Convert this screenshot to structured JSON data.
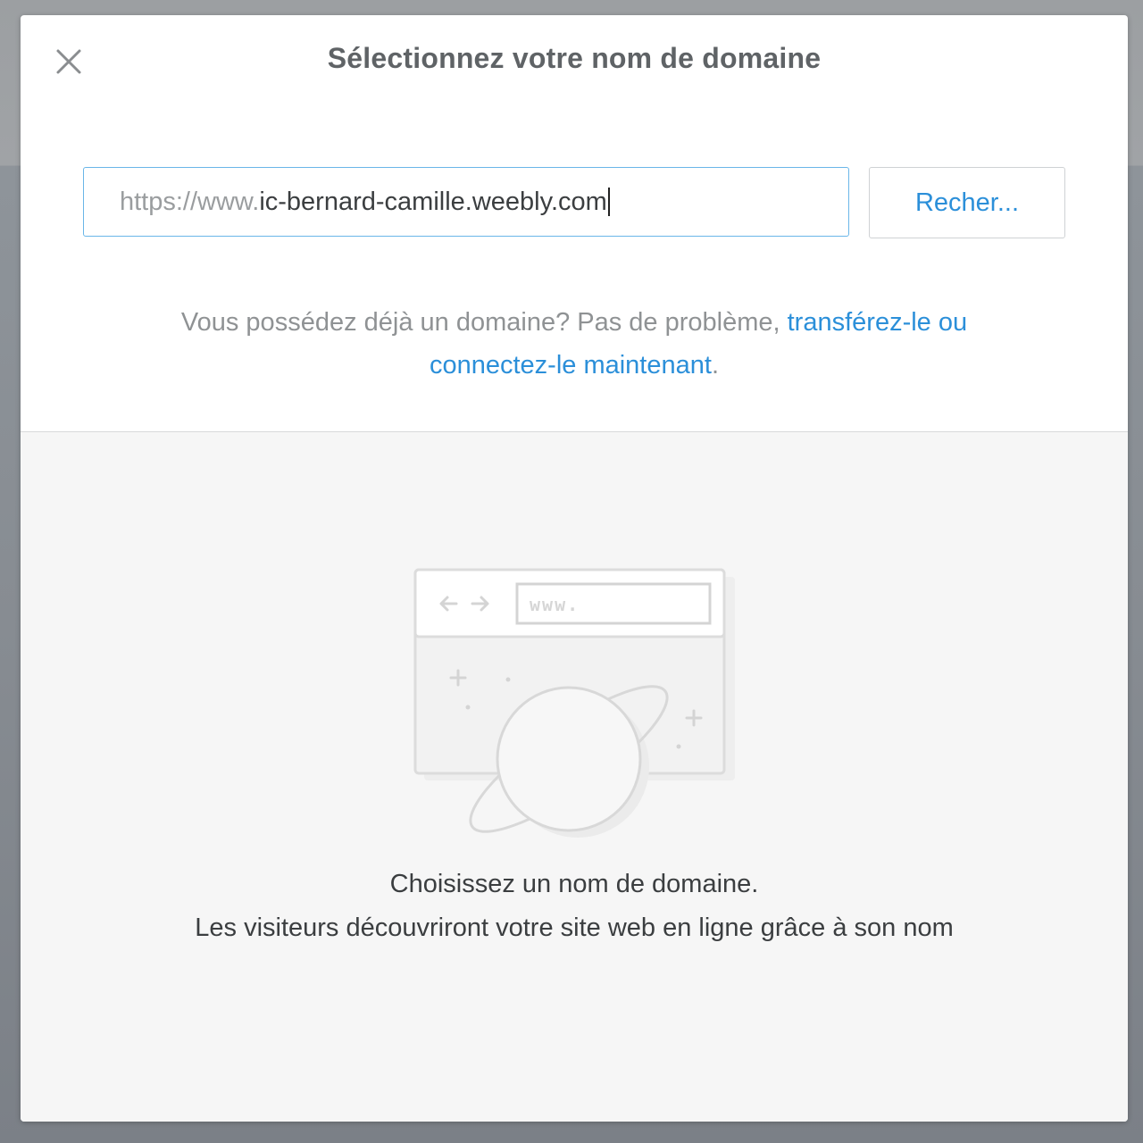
{
  "modal": {
    "title": "Sélectionnez votre nom de domaine",
    "close_icon": "close-icon"
  },
  "search": {
    "prefix": "https://www.",
    "value": "ic-bernard-camille.weebly.com",
    "button_label": "Recher..."
  },
  "helper": {
    "text": "Vous possédez déjà un domaine? Pas de problème, ",
    "link_text": "transférez-le ou connectez-le maintenant",
    "suffix": "."
  },
  "empty_state": {
    "illustration_url_text": "www.",
    "illustration_icon": "browser-planet-illustration",
    "title": "Choisissez un nom de domaine.",
    "subtitle": "Les visiteurs découvriront votre site web en ligne grâce à son nom"
  },
  "colors": {
    "accent": "#2b8fd9",
    "input_border": "#6ab6e8",
    "title": "#5f6366",
    "muted_text": "#8f9294",
    "lower_background": "#f6f6f6"
  }
}
